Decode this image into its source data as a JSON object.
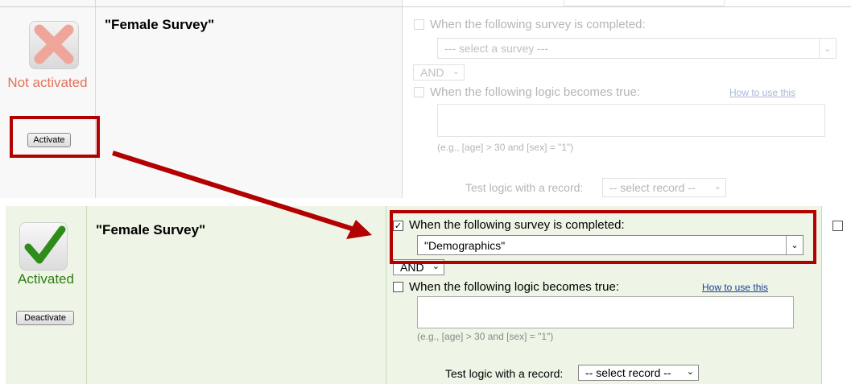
{
  "top": {
    "status": "Not activated",
    "button": "Activate",
    "title": "\"Female Survey\"",
    "survey_label": "When the following survey is completed:",
    "survey_select": "--- select a survey ---",
    "and_select": "AND",
    "logic_label": "When the following logic becomes true:",
    "how_link": "How to use this",
    "hint": "(e.g., [age] > 30 and [sex] = \"1\")",
    "test_label": "Test logic with a record:",
    "record_select": "-- select record --"
  },
  "bottom": {
    "status": "Activated",
    "button": "Deactivate",
    "title": "\"Female Survey\"",
    "survey_label": "When the following survey is completed:",
    "survey_select": "\"Demographics\"",
    "and_select": "AND",
    "logic_label": "When the following logic becomes true:",
    "how_link": "How to use this",
    "hint": "(e.g., [age] > 30 and [sex] = \"1\")",
    "test_label": "Test logic with a record:",
    "record_select": "-- select record --"
  },
  "colors": {
    "highlight": "#b30000",
    "not_activated": "#e0735a",
    "activated": "#2e7d0f",
    "active_bg": "#eef5e6"
  },
  "icons": {
    "top_status": "red-x-icon",
    "bottom_status": "green-check-icon",
    "arrow": "red-arrow"
  }
}
